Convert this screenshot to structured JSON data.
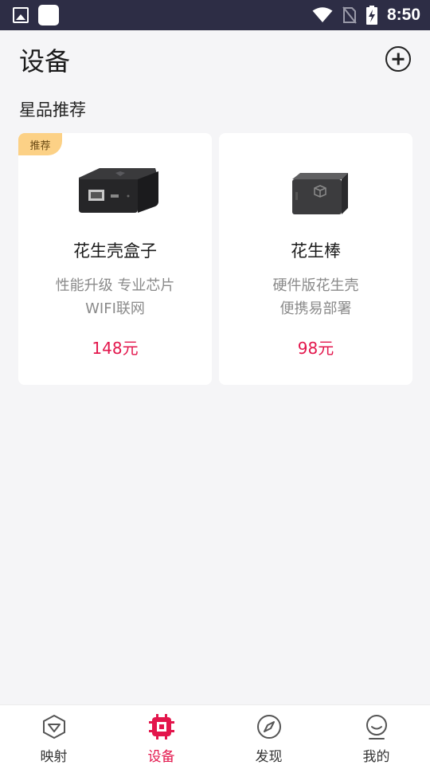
{
  "status_bar": {
    "time": "8:50"
  },
  "header": {
    "title": "设备"
  },
  "section": {
    "title": "星品推荐"
  },
  "products": [
    {
      "badge": "推荐",
      "name": "花生壳盒子",
      "desc_line1": "性能升级 专业芯片",
      "desc_line2": "WIFI联网",
      "price": "148元"
    },
    {
      "name": "花生棒",
      "desc_line1": "硬件版花生壳",
      "desc_line2": "便携易部署",
      "price": "98元"
    }
  ],
  "bottom_nav": {
    "items": [
      {
        "label": "映射",
        "icon": "mapping-shield-icon"
      },
      {
        "label": "设备",
        "icon": "chip-icon",
        "active": true
      },
      {
        "label": "发现",
        "icon": "compass-icon"
      },
      {
        "label": "我的",
        "icon": "profile-icon"
      }
    ]
  },
  "colors": {
    "accent": "#e3164c",
    "status_bar": "#2d2d45",
    "badge": "#fcd186"
  }
}
